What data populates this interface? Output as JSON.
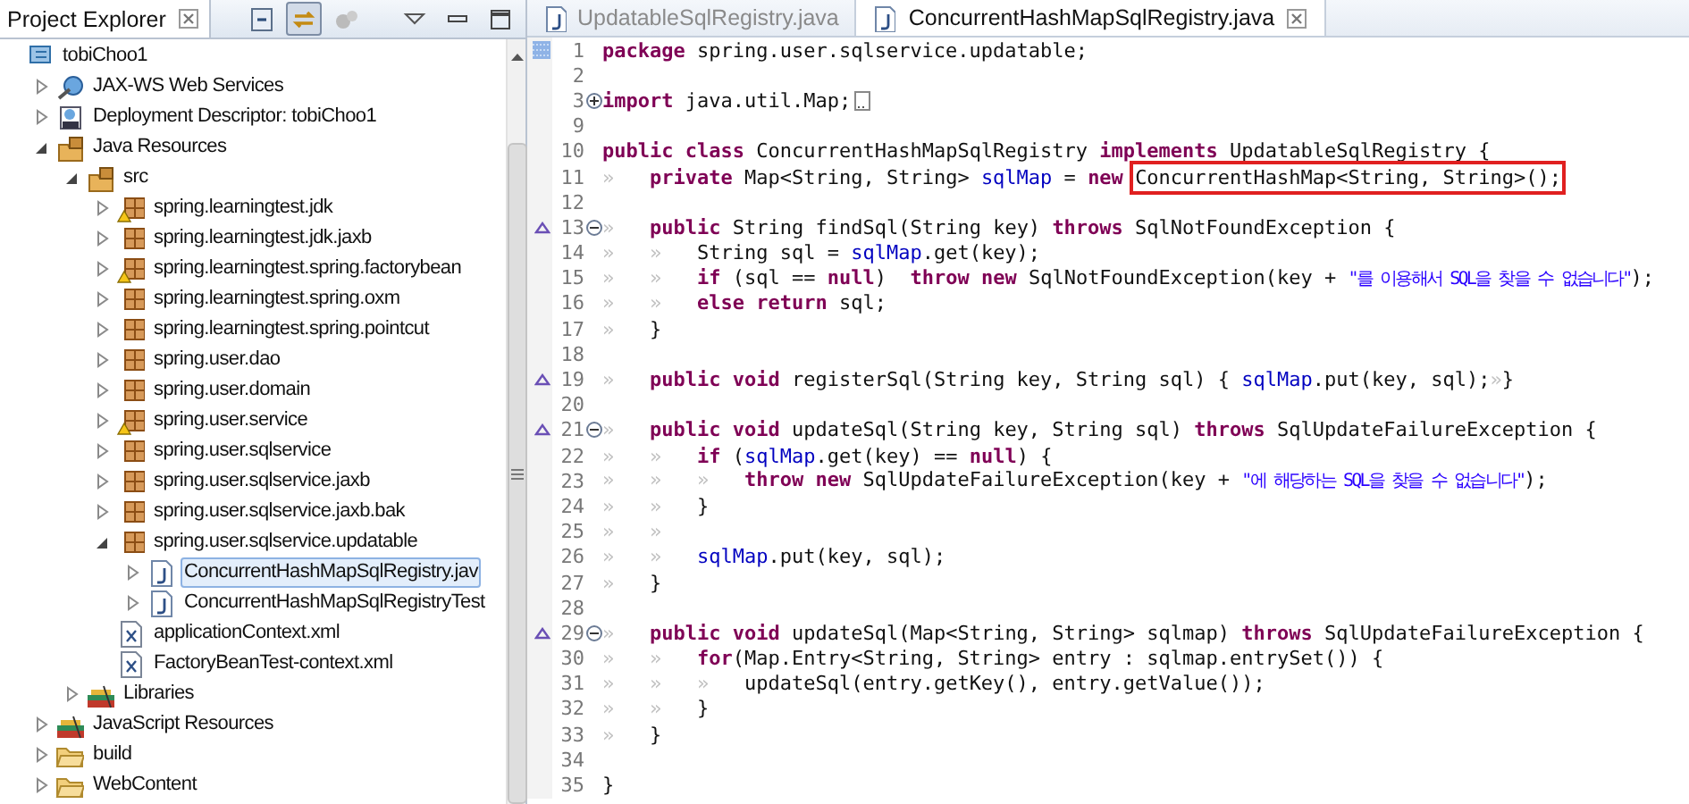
{
  "explorer": {
    "title": "Project Explorer",
    "toolbar": [
      {
        "kind": "collapse",
        "pressed": false
      },
      {
        "kind": "link",
        "pressed": true
      },
      {
        "kind": "filter",
        "pressed": false
      },
      {
        "kind": "menu",
        "pressed": false
      },
      {
        "kind": "minimize",
        "pressed": false
      },
      {
        "kind": "maximize",
        "pressed": false
      }
    ],
    "tree": [
      {
        "label": "tobiChoo1",
        "kind": "project",
        "selected": false,
        "children": [
          {
            "label": "JAX-WS Web Services",
            "kind": "webservice",
            "expanded": false,
            "selected": false
          },
          {
            "label": "Deployment Descriptor: tobiChoo1",
            "kind": "descriptor",
            "expanded": false,
            "selected": false
          },
          {
            "label": "Java Resources",
            "kind": "javares",
            "expanded": true,
            "selected": false,
            "children": [
              {
                "label": "src",
                "kind": "srcfolder",
                "expanded": true,
                "selected": false,
                "children": [
                  {
                    "label": "spring.learningtest.jdk",
                    "kind": "package",
                    "warning": true,
                    "expanded": false,
                    "selected": false
                  },
                  {
                    "label": "spring.learningtest.jdk.jaxb",
                    "kind": "package",
                    "warning": false,
                    "expanded": false,
                    "selected": false
                  },
                  {
                    "label": "spring.learningtest.spring.factorybean",
                    "kind": "package",
                    "warning": true,
                    "expanded": false,
                    "selected": false
                  },
                  {
                    "label": "spring.learningtest.spring.oxm",
                    "kind": "package",
                    "warning": false,
                    "expanded": false,
                    "selected": false
                  },
                  {
                    "label": "spring.learningtest.spring.pointcut",
                    "kind": "package",
                    "warning": false,
                    "expanded": false,
                    "selected": false
                  },
                  {
                    "label": "spring.user.dao",
                    "kind": "package",
                    "warning": false,
                    "expanded": false,
                    "selected": false
                  },
                  {
                    "label": "spring.user.domain",
                    "kind": "package",
                    "warning": false,
                    "expanded": false,
                    "selected": false
                  },
                  {
                    "label": "spring.user.service",
                    "kind": "package",
                    "warning": true,
                    "expanded": false,
                    "selected": false
                  },
                  {
                    "label": "spring.user.sqlservice",
                    "kind": "package",
                    "warning": false,
                    "expanded": false,
                    "selected": false
                  },
                  {
                    "label": "spring.user.sqlservice.jaxb",
                    "kind": "package",
                    "warning": false,
                    "expanded": false,
                    "selected": false
                  },
                  {
                    "label": "spring.user.sqlservice.jaxb.bak",
                    "kind": "package",
                    "warning": false,
                    "expanded": false,
                    "selected": false
                  },
                  {
                    "label": "spring.user.sqlservice.updatable",
                    "kind": "package",
                    "warning": false,
                    "expanded": true,
                    "selected": false,
                    "children": [
                      {
                        "label": "ConcurrentHashMapSqlRegistry.jav",
                        "kind": "javafile",
                        "expanded": false,
                        "selected": true
                      },
                      {
                        "label": "ConcurrentHashMapSqlRegistryTest",
                        "kind": "javafile",
                        "expanded": false,
                        "selected": false
                      }
                    ]
                  },
                  {
                    "label": "applicationContext.xml",
                    "kind": "xmlfile",
                    "selected": false
                  },
                  {
                    "label": "FactoryBeanTest-context.xml",
                    "kind": "xmlfile",
                    "selected": false
                  }
                ]
              },
              {
                "label": "Libraries",
                "kind": "library",
                "expanded": false,
                "selected": false
              }
            ]
          },
          {
            "label": "JavaScript Resources",
            "kind": "library",
            "expanded": false,
            "selected": false
          },
          {
            "label": "build",
            "kind": "folder",
            "expanded": false,
            "selected": false
          },
          {
            "label": "WebContent",
            "kind": "folder",
            "expanded": false,
            "selected": false
          }
        ]
      }
    ]
  },
  "editor": {
    "tabs": [
      {
        "label": "UpdatableSqlRegistry.java",
        "selected": false
      },
      {
        "label": "ConcurrentHashMapSqlRegistry.java",
        "selected": true
      }
    ],
    "lines": [
      {
        "number": "1",
        "marker": true,
        "tokens": [
          {
            "kind": "keyword",
            "text": "package"
          },
          {
            "kind": "plain",
            "text": " spring.user.sqlservice.updatable;"
          }
        ]
      },
      {
        "number": "2"
      },
      {
        "number": "3",
        "foldable": true,
        "folded": true,
        "tokens": [
          {
            "kind": "keyword",
            "text": "import"
          },
          {
            "kind": "plain",
            "text": " java.util.Map;"
          }
        ]
      },
      {
        "number": "9"
      },
      {
        "number": "10",
        "tokens": [
          {
            "kind": "keyword",
            "text": "public class"
          },
          {
            "kind": "plain",
            "text": " ConcurrentHashMapSqlRegistry "
          },
          {
            "kind": "keyword",
            "text": "implements"
          },
          {
            "kind": "plain",
            "text": " UpdatableSqlRegistry {"
          }
        ]
      },
      {
        "number": "11",
        "tokens": [
          {
            "kind": "tab",
            "text": "»   "
          },
          {
            "kind": "keyword",
            "text": "private"
          },
          {
            "kind": "plain",
            "text": " Map<String, String> "
          },
          {
            "kind": "field",
            "text": "sqlMap"
          },
          {
            "kind": "plain",
            "text": " = "
          },
          {
            "kind": "keyword",
            "text": "new"
          },
          {
            "kind": "boxed",
            "text": "ConcurrentHashMap<String, String>();"
          }
        ]
      },
      {
        "number": "12"
      },
      {
        "number": "13",
        "override": true,
        "foldable": true,
        "folded": false,
        "tokens": [
          {
            "kind": "tab",
            "text": "»   "
          },
          {
            "kind": "keyword",
            "text": "public"
          },
          {
            "kind": "plain",
            "text": " String findSql(String key) "
          },
          {
            "kind": "keyword",
            "text": "throws"
          },
          {
            "kind": "plain",
            "text": " SqlNotFoundException {"
          }
        ]
      },
      {
        "number": "14",
        "tokens": [
          {
            "kind": "tab",
            "text": "»   »   "
          },
          {
            "kind": "plain",
            "text": "String sql = "
          },
          {
            "kind": "field",
            "text": "sqlMap"
          },
          {
            "kind": "plain",
            "text": ".get(key);"
          }
        ]
      },
      {
        "number": "15",
        "tokens": [
          {
            "kind": "tab",
            "text": "»   »   "
          },
          {
            "kind": "keyword",
            "text": "if"
          },
          {
            "kind": "plain",
            "text": " (sql == "
          },
          {
            "kind": "keyword",
            "text": "null"
          },
          {
            "kind": "plain",
            "text": ")  "
          },
          {
            "kind": "keyword",
            "text": "throw new"
          },
          {
            "kind": "plain",
            "text": " SqlNotFoundException(key + "
          },
          {
            "kind": "string",
            "text": "\"를 이용해서 SQL을 찾을 수 없습니다\""
          },
          {
            "kind": "plain",
            "text": ");"
          }
        ]
      },
      {
        "number": "16",
        "tokens": [
          {
            "kind": "tab",
            "text": "»   »   "
          },
          {
            "kind": "keyword",
            "text": "else return"
          },
          {
            "kind": "plain",
            "text": " sql;"
          }
        ]
      },
      {
        "number": "17",
        "tokens": [
          {
            "kind": "tab",
            "text": "»   "
          },
          {
            "kind": "plain",
            "text": "}"
          }
        ]
      },
      {
        "number": "18"
      },
      {
        "number": "19",
        "override": true,
        "tokens": [
          {
            "kind": "tab",
            "text": "»   "
          },
          {
            "kind": "keyword",
            "text": "public void"
          },
          {
            "kind": "plain",
            "text": " registerSql(String key, String sql) { "
          },
          {
            "kind": "field",
            "text": "sqlMap"
          },
          {
            "kind": "plain",
            "text": ".put(key, sql);"
          },
          {
            "kind": "tab",
            "text": "»"
          },
          {
            "kind": "plain",
            "text": "}"
          }
        ]
      },
      {
        "number": "20"
      },
      {
        "number": "21",
        "override": true,
        "foldable": true,
        "folded": false,
        "tokens": [
          {
            "kind": "tab",
            "text": "»   "
          },
          {
            "kind": "keyword",
            "text": "public void"
          },
          {
            "kind": "plain",
            "text": " updateSql(String key, String sql) "
          },
          {
            "kind": "keyword",
            "text": "throws"
          },
          {
            "kind": "plain",
            "text": " SqlUpdateFailureException {"
          }
        ]
      },
      {
        "number": "22",
        "tokens": [
          {
            "kind": "tab",
            "text": "»   »   "
          },
          {
            "kind": "keyword",
            "text": "if"
          },
          {
            "kind": "plain",
            "text": " ("
          },
          {
            "kind": "field",
            "text": "sqlMap"
          },
          {
            "kind": "plain",
            "text": ".get(key) == "
          },
          {
            "kind": "keyword",
            "text": "null"
          },
          {
            "kind": "plain",
            "text": ") {"
          }
        ]
      },
      {
        "number": "23",
        "tokens": [
          {
            "kind": "tab",
            "text": "»   »   »   "
          },
          {
            "kind": "keyword",
            "text": "throw new"
          },
          {
            "kind": "plain",
            "text": " SqlUpdateFailureException(key + "
          },
          {
            "kind": "string",
            "text": "\"에 해당하는 SQL을 찾을 수 없습니다\""
          },
          {
            "kind": "plain",
            "text": ");"
          }
        ]
      },
      {
        "number": "24",
        "tokens": [
          {
            "kind": "tab",
            "text": "»   »   "
          },
          {
            "kind": "plain",
            "text": "}"
          }
        ]
      },
      {
        "number": "25",
        "tokens": [
          {
            "kind": "tab",
            "text": "»   »"
          }
        ]
      },
      {
        "number": "26",
        "tokens": [
          {
            "kind": "tab",
            "text": "»   »   "
          },
          {
            "kind": "field",
            "text": "sqlMap"
          },
          {
            "kind": "plain",
            "text": ".put(key, sql);"
          }
        ]
      },
      {
        "number": "27",
        "tokens": [
          {
            "kind": "tab",
            "text": "»   "
          },
          {
            "kind": "plain",
            "text": "}"
          }
        ]
      },
      {
        "number": "28"
      },
      {
        "number": "29",
        "override": true,
        "foldable": true,
        "folded": false,
        "tokens": [
          {
            "kind": "tab",
            "text": "»   "
          },
          {
            "kind": "keyword",
            "text": "public void"
          },
          {
            "kind": "plain",
            "text": " updateSql(Map<String, String> sqlmap) "
          },
          {
            "kind": "keyword",
            "text": "throws"
          },
          {
            "kind": "plain",
            "text": " SqlUpdateFailureException {"
          }
        ]
      },
      {
        "number": "30",
        "tokens": [
          {
            "kind": "tab",
            "text": "»   »   "
          },
          {
            "kind": "keyword",
            "text": "for"
          },
          {
            "kind": "plain",
            "text": "(Map.Entry<String, String> entry : sqlmap.entrySet()) {"
          }
        ]
      },
      {
        "number": "31",
        "tokens": [
          {
            "kind": "tab",
            "text": "»   »   »   "
          },
          {
            "kind": "plain",
            "text": "updateSql(entry.getKey(), entry.getValue());"
          }
        ]
      },
      {
        "number": "32",
        "tokens": [
          {
            "kind": "tab",
            "text": "»   »   "
          },
          {
            "kind": "plain",
            "text": "}"
          }
        ]
      },
      {
        "number": "33",
        "tokens": [
          {
            "kind": "tab",
            "text": "»   "
          },
          {
            "kind": "plain",
            "text": "}"
          }
        ]
      },
      {
        "number": "34"
      },
      {
        "number": "35",
        "tokens": [
          {
            "kind": "plain",
            "text": "}"
          }
        ]
      }
    ]
  }
}
